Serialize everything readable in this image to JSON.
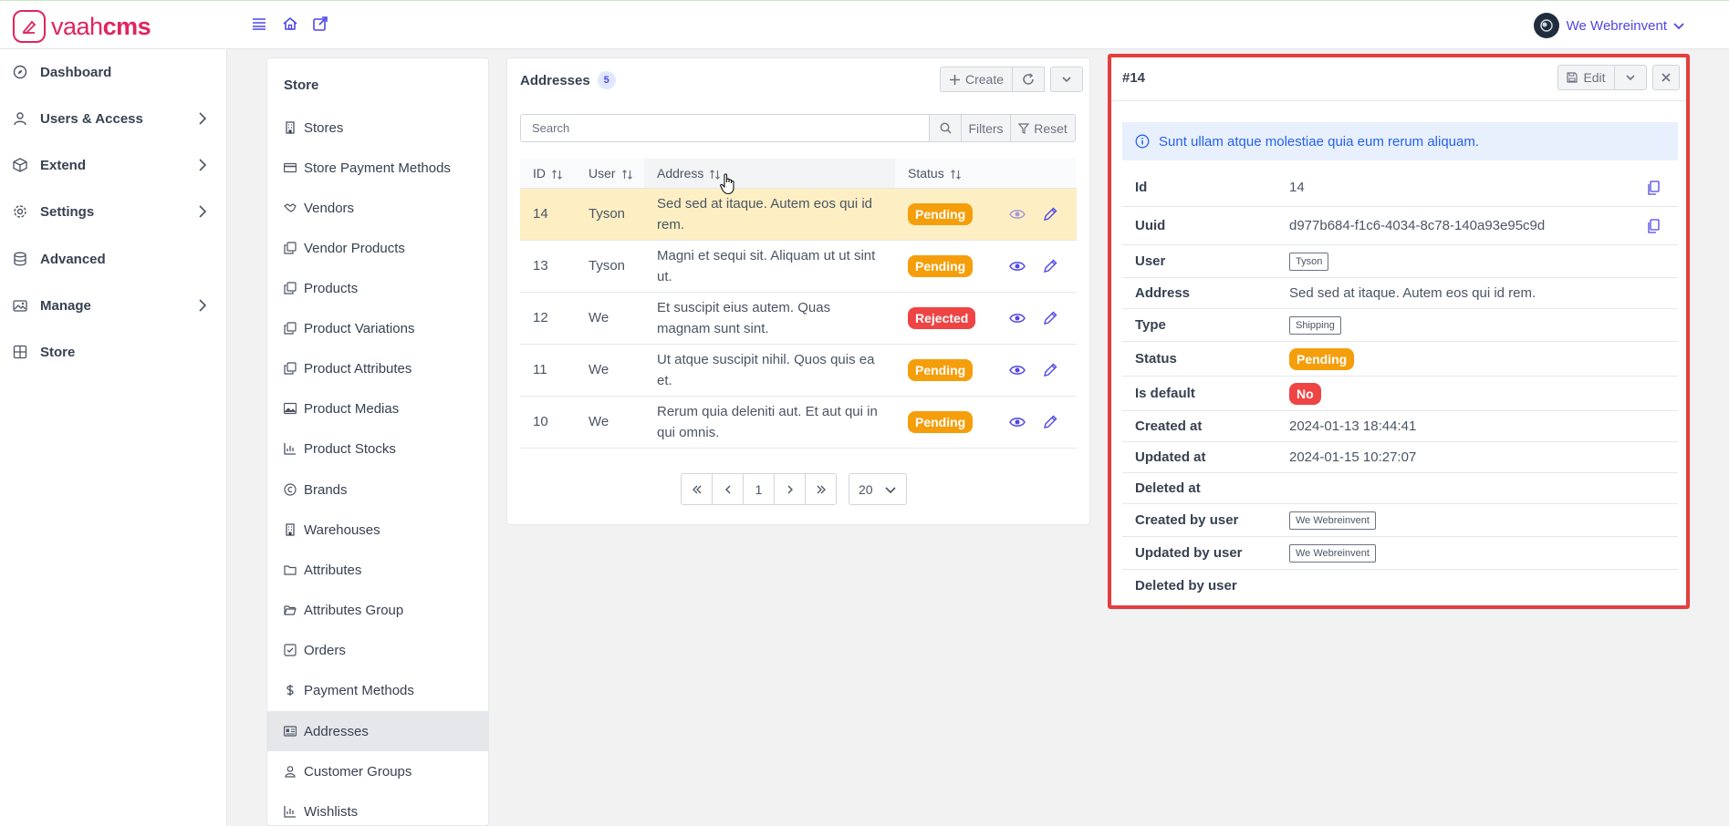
{
  "app": {
    "logo_light": "vaah",
    "logo_bold": "cms",
    "user_name": "We Webreinvent"
  },
  "colors": {
    "accent": "#4f46e5",
    "brand": "#e0245e",
    "pending": "#f59e0b",
    "rejected": "#ef4444",
    "highlight": "#fdefc3"
  },
  "nav": [
    {
      "label": "Dashboard",
      "icon": "compass-icon",
      "submenu": false
    },
    {
      "label": "Users & Access",
      "icon": "user-icon",
      "submenu": true
    },
    {
      "label": "Extend",
      "icon": "box-icon",
      "submenu": true
    },
    {
      "label": "Settings",
      "icon": "gear-icon",
      "submenu": true
    },
    {
      "label": "Advanced",
      "icon": "database-icon",
      "submenu": false
    },
    {
      "label": "Manage",
      "icon": "images-icon",
      "submenu": true
    },
    {
      "label": "Store",
      "icon": "table-icon",
      "submenu": false
    }
  ],
  "store_menu": {
    "title": "Store",
    "items": [
      {
        "label": "Stores",
        "icon": "building-icon"
      },
      {
        "label": "Store Payment Methods",
        "icon": "credit-card-icon"
      },
      {
        "label": "Vendors",
        "icon": "handshake-icon"
      },
      {
        "label": "Vendor Products",
        "icon": "clone-icon"
      },
      {
        "label": "Products",
        "icon": "clone-icon"
      },
      {
        "label": "Product Variations",
        "icon": "clone-icon"
      },
      {
        "label": "Product Attributes",
        "icon": "clone-icon"
      },
      {
        "label": "Product Medias",
        "icon": "image-icon"
      },
      {
        "label": "Product Stocks",
        "icon": "chart-bar-icon"
      },
      {
        "label": "Brands",
        "icon": "copyright-icon"
      },
      {
        "label": "Warehouses",
        "icon": "building-icon"
      },
      {
        "label": "Attributes",
        "icon": "folder-icon"
      },
      {
        "label": "Attributes Group",
        "icon": "folder-open-icon"
      },
      {
        "label": "Orders",
        "icon": "check-square-icon"
      },
      {
        "label": "Payment Methods",
        "icon": "dollar-icon"
      },
      {
        "label": "Addresses",
        "icon": "id-card-icon",
        "active": true
      },
      {
        "label": "Customer Groups",
        "icon": "user-icon"
      },
      {
        "label": "Wishlists",
        "icon": "chart-bar-icon"
      }
    ]
  },
  "list": {
    "title": "Addresses",
    "count": "5",
    "create_label": "Create",
    "search_placeholder": "Search",
    "filters_label": "Filters",
    "reset_label": "Reset",
    "columns": {
      "id": "ID",
      "user": "User",
      "address": "Address",
      "status": "Status"
    },
    "rows": [
      {
        "id": "14",
        "user": "Tyson",
        "address": "Sed sed at itaque. Autem eos qui id rem.",
        "status": "Pending",
        "highlight": true
      },
      {
        "id": "13",
        "user": "Tyson",
        "address": "Magni et sequi sit. Aliquam ut ut sint ut.",
        "status": "Pending"
      },
      {
        "id": "12",
        "user": "We",
        "address": "Et suscipit eius autem. Quas magnam sunt sint.",
        "status": "Rejected"
      },
      {
        "id": "11",
        "user": "We",
        "address": "Ut atque suscipit nihil. Quos quis ea et.",
        "status": "Pending"
      },
      {
        "id": "10",
        "user": "We",
        "address": "Rerum quia deleniti aut. Et aut qui in qui omnis.",
        "status": "Pending"
      }
    ],
    "pagination": {
      "current_page": "1",
      "per_page": "20"
    }
  },
  "detail": {
    "title": "#14",
    "edit_label": "Edit",
    "info_message": "Sunt ullam atque molestiae quia eum rerum aliquam.",
    "fields": {
      "id_label": "Id",
      "id_value": "14",
      "uuid_label": "Uuid",
      "uuid_value": "d977b684-f1c6-4034-8c78-140a93e95c9d",
      "user_label": "User",
      "user_value": "Tyson",
      "address_label": "Address",
      "address_value": "Sed sed at itaque. Autem eos qui id rem.",
      "type_label": "Type",
      "type_value": "Shipping",
      "status_label": "Status",
      "status_value": "Pending",
      "is_default_label": "Is default",
      "is_default_value": "No",
      "created_at_label": "Created at",
      "created_at_value": "2024-01-13 18:44:41",
      "updated_at_label": "Updated at",
      "updated_at_value": "2024-01-15 10:27:07",
      "deleted_at_label": "Deleted at",
      "created_by_label": "Created by user",
      "created_by_value": "We Webreinvent",
      "updated_by_label": "Updated by user",
      "updated_by_value": "We Webreinvent",
      "deleted_by_label": "Deleted by user"
    }
  }
}
